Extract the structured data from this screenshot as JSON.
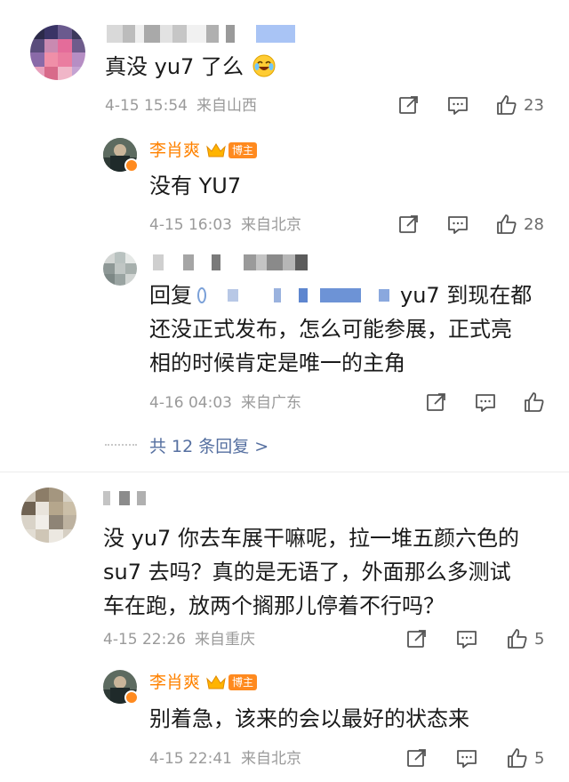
{
  "comments": [
    {
      "text": "真没 yu7 了么",
      "emoji": "face-with-tears-of-joy",
      "time": "4-15 15:54",
      "location": "来自山西",
      "likes": "23",
      "replies": [
        {
          "username": "李肖爽",
          "badge": "博主",
          "text": "没有 YU7",
          "time": "4-15 16:03",
          "location": "来自北京",
          "likes": "28"
        },
        {
          "reply_prefix": "回复",
          "text_line1_end": "yu7 到现在都",
          "text_line2": "还没正式发布，怎么可能参展，正式亮",
          "text_line3": "相的时候肯定是唯一的主角",
          "time": "4-16 04:03",
          "location": "来自广东"
        }
      ],
      "more_replies": "共 12 条回复 >"
    },
    {
      "text_line1": "没 yu7 你去车展干嘛呢，拉一堆五颜六色的",
      "text_line2": "su7 去吗？真的是无语了，外面那么多测试",
      "text_line3": "车在跑，放两个搁那儿停着不行吗？",
      "time": "4-15 22:26",
      "location": "来自重庆",
      "likes": "5",
      "replies": [
        {
          "username": "李肖爽",
          "badge": "博主",
          "text": "别着急，该来的会以最好的状态来",
          "time": "4-15 22:41",
          "location": "来自北京",
          "likes": "5"
        }
      ]
    }
  ],
  "colors": {
    "accent_orange": "#ff8200",
    "link_blue": "#556fa0",
    "meta_gray": "#9a9a9a"
  }
}
